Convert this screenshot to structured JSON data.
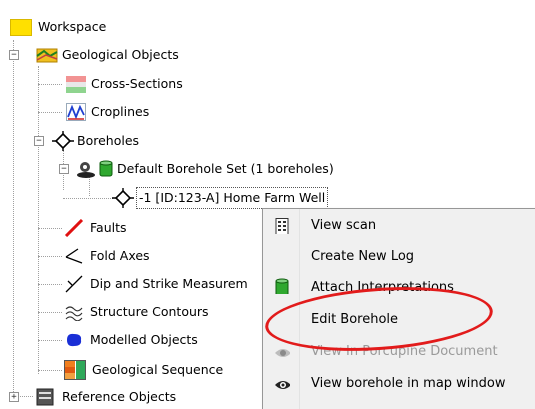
{
  "tree": {
    "root_label": "Workspace",
    "geological_objects": {
      "label": "Geological Objects",
      "children": {
        "cross_sections": "Cross-Sections",
        "croplines": "Croplines",
        "boreholes": "Boreholes",
        "borehole_set": "Default Borehole Set (1 boreholes)",
        "borehole_item": "-1 [ID:123-A]  Home Farm Well",
        "faults": "Faults",
        "fold_axes": "Fold Axes",
        "dip_strike": "Dip and Strike Measurem",
        "structure_contours": "Structure Contours",
        "modelled_objects": "Modelled Objects",
        "geological_sequence": "Geological Sequence"
      }
    },
    "reference_objects": "Reference Objects"
  },
  "context_menu": {
    "items": [
      {
        "label": "View scan",
        "icon": "scan-icon",
        "enabled": true
      },
      {
        "label": "Create New Log",
        "icon": "",
        "enabled": true
      },
      {
        "label": "Attach Interpretations",
        "icon": "interpretation-icon",
        "enabled": true
      },
      {
        "label": "Edit Borehole",
        "icon": "",
        "enabled": true
      },
      {
        "label": "View In Porcupine Document",
        "icon": "eye-icon",
        "enabled": false
      },
      {
        "label": "View borehole in map window",
        "icon": "eye-icon",
        "enabled": true
      }
    ]
  },
  "colors": {
    "annotation_ellipse": "#e21b1b",
    "menu_background": "#f0f0f0",
    "disabled_text": "#9a9a9a"
  }
}
